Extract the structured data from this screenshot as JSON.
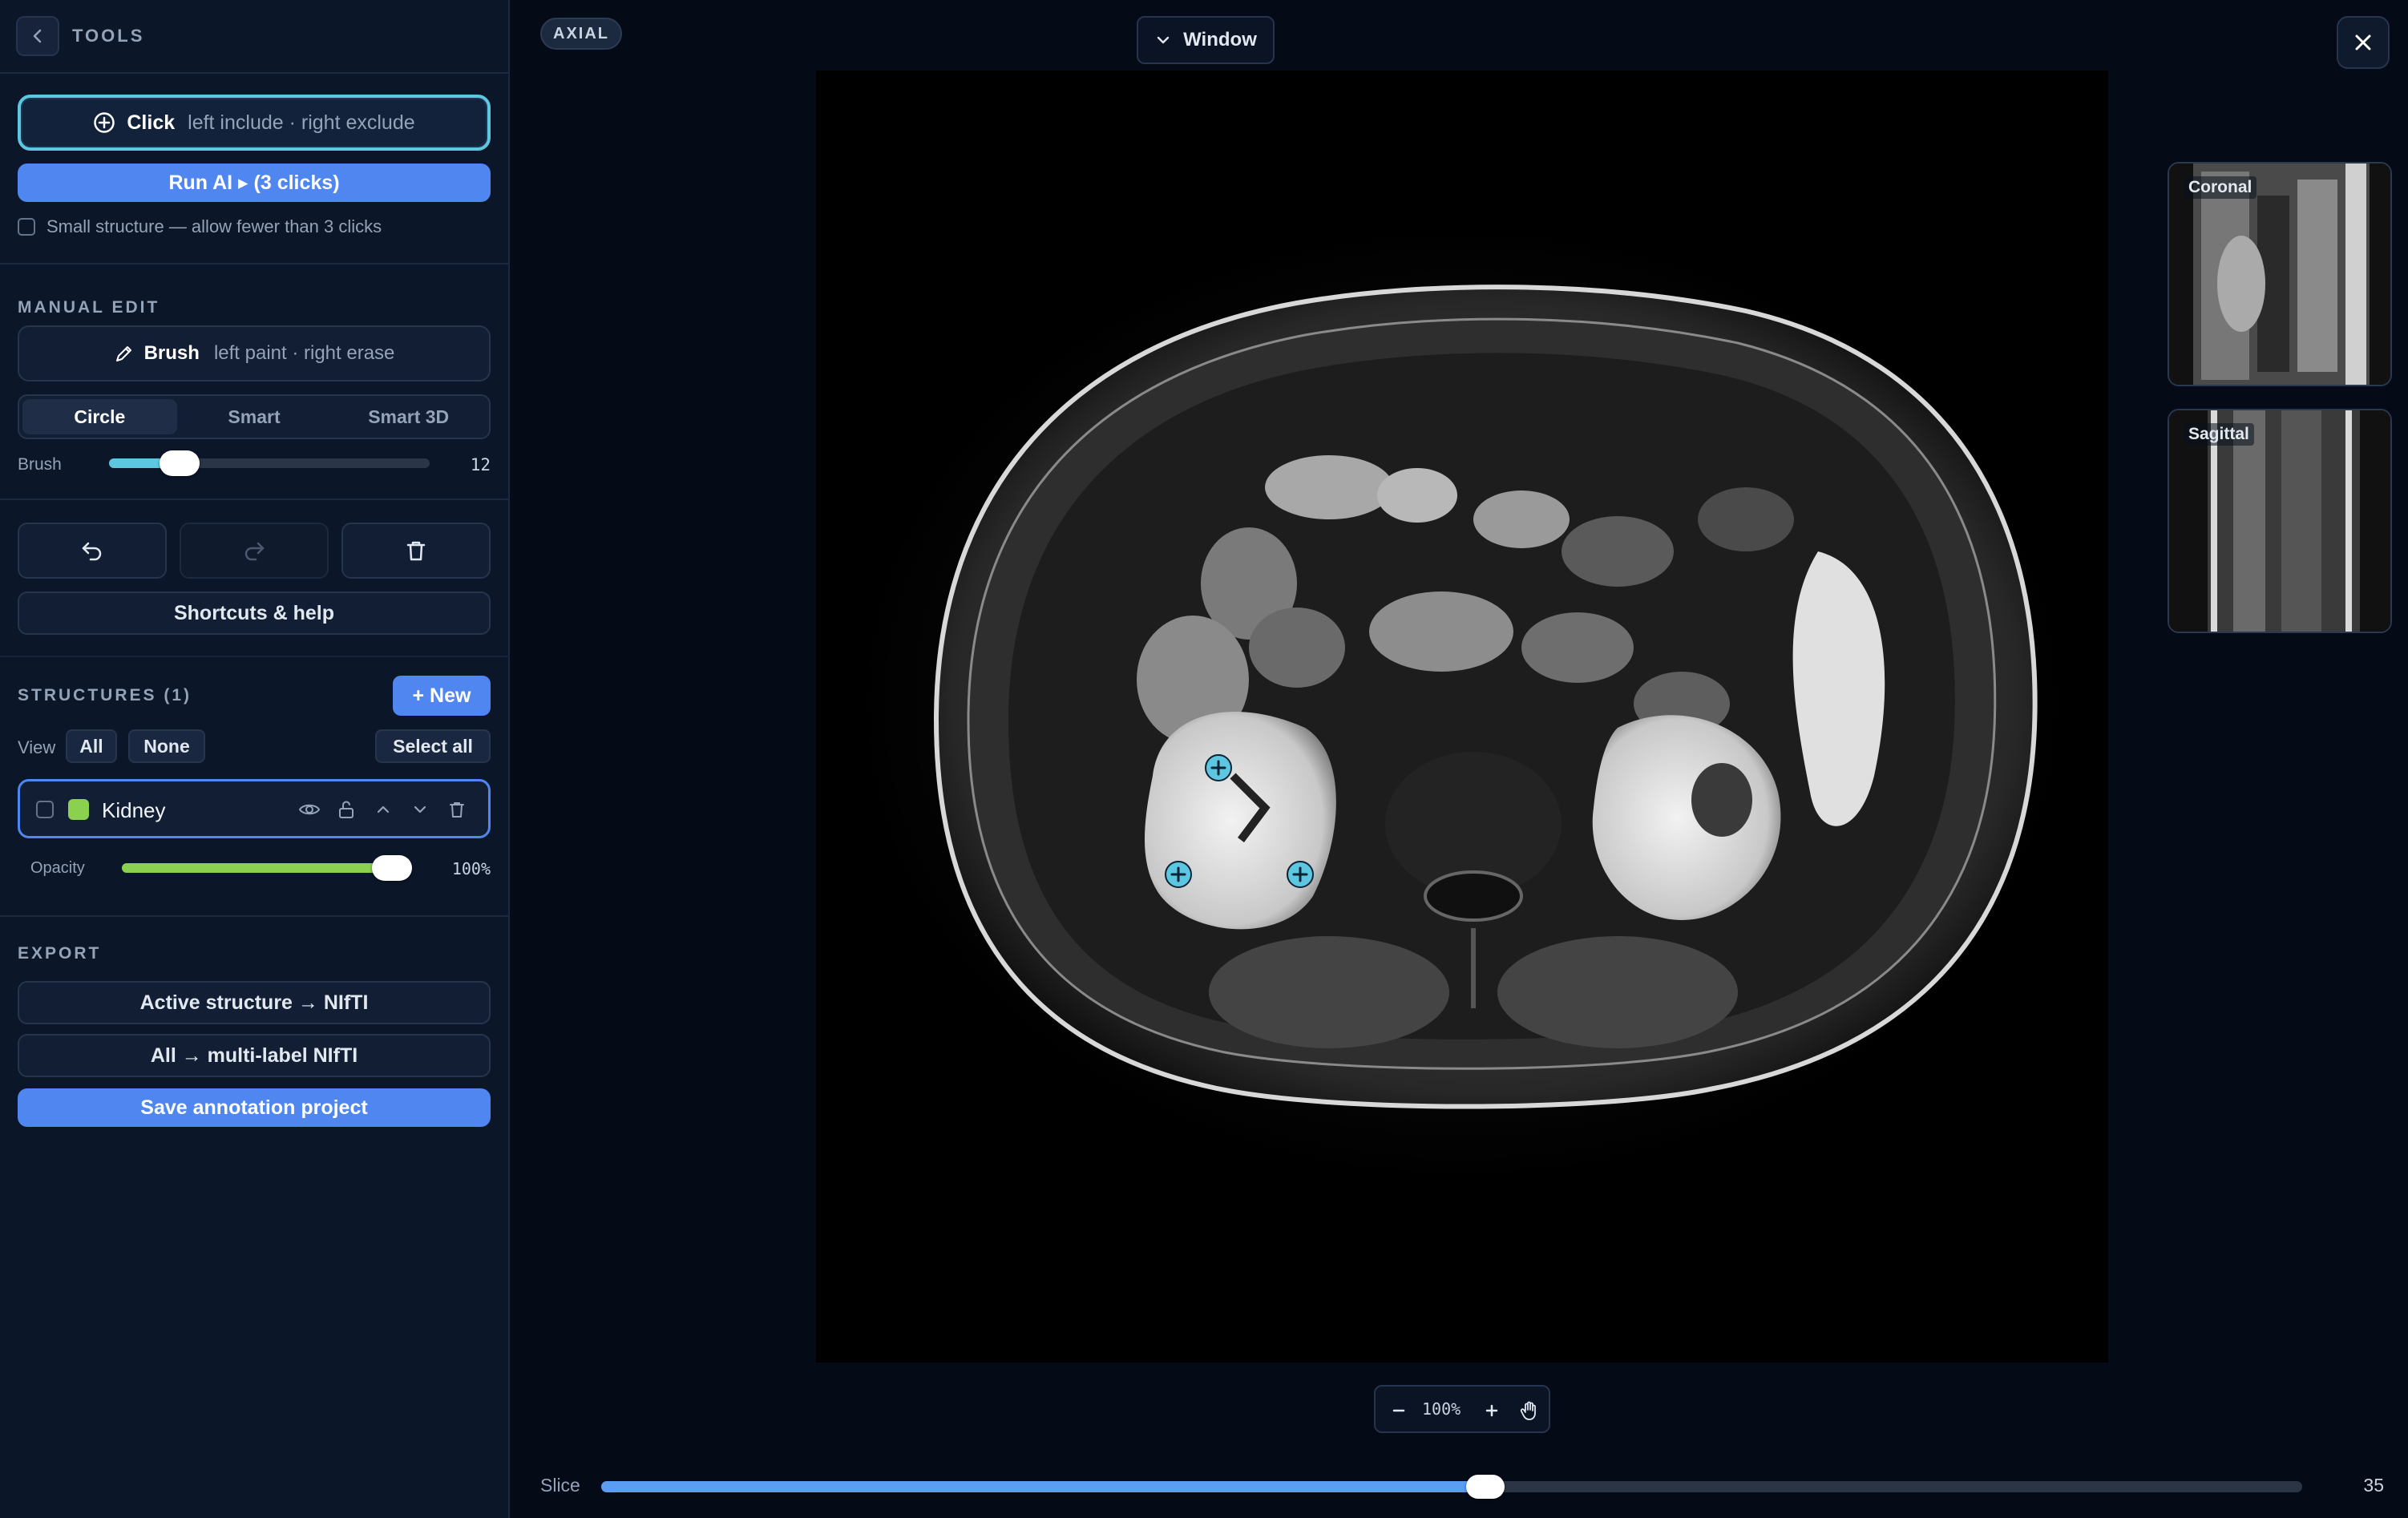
{
  "sidebar": {
    "title": "TOOLS",
    "click_tool": {
      "name": "Click",
      "hint": "left include · right exclude"
    },
    "run_ai_label": "Run AI ▸ (3 clicks)",
    "small_structure_label": "Small structure — allow fewer than 3 clicks",
    "manual_edit": {
      "heading": "MANUAL EDIT",
      "brush_tool": {
        "name": "Brush",
        "hint": "left paint · right erase"
      },
      "modes": [
        "Circle",
        "Smart",
        "Smart 3D"
      ],
      "active_mode": "Circle",
      "brush_label": "Brush",
      "brush_size": "12",
      "brush_fraction": 0.22
    },
    "shortcuts_label": "Shortcuts & help",
    "structures": {
      "heading": "STRUCTURES (1)",
      "new_label": "+ New",
      "view_label": "View",
      "view_all": "All",
      "view_none": "None",
      "select_all": "Select all",
      "items": [
        {
          "name": "Kidney",
          "color": "#8bd14f"
        }
      ],
      "opacity_label": "Opacity",
      "opacity_value": "100%",
      "opacity_fraction": 1.0
    },
    "export": {
      "heading": "EXPORT",
      "active_label": "Active structure → NIfTI",
      "all_label": "All → multi-label NIfTI",
      "save_label": "Save annotation project"
    }
  },
  "main": {
    "view_badge": "AXIAL",
    "window_label": "Window",
    "thumbnails": [
      "Coronal",
      "Sagittal"
    ],
    "zoom_value": "100%",
    "slice_label": "Slice",
    "slice_value": "35",
    "slice_fraction": 0.52
  },
  "colors": {
    "accent": "#4f86f0",
    "click_ring": "#5dc7e2",
    "structure_kidney": "#8bd14f",
    "background": "#050a17",
    "panel": "#0b1628"
  },
  "icons": [
    "chevron-left-icon",
    "plus-circle-icon",
    "pencil-icon",
    "undo-icon",
    "redo-icon",
    "trash-icon",
    "eye-icon",
    "unlock-icon",
    "chevron-up-icon",
    "chevron-down-icon",
    "close-icon",
    "minus-icon",
    "plus-icon",
    "hand-icon"
  ]
}
